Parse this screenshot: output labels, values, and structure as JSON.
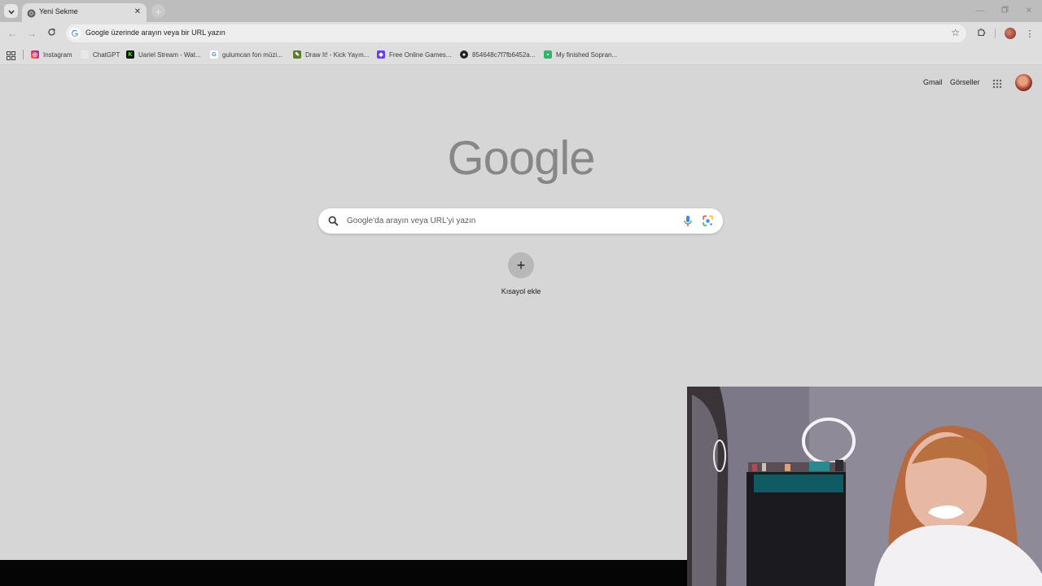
{
  "tab": {
    "title": "Yeni Sekme"
  },
  "omnibox": {
    "text": "Google üzerinde arayın veya bir URL yazın"
  },
  "bookmarks": [
    {
      "label": "Instagram",
      "icon": "instagram-icon",
      "color": "#d6249f"
    },
    {
      "label": "ChatGPT",
      "icon": "chatgpt-icon",
      "color": "#e8e8e8"
    },
    {
      "label": "Uariel Stream - Wat...",
      "icon": "kick-icon",
      "color": "#111111"
    },
    {
      "label": "gulumcan fon müzi...",
      "icon": "google-icon",
      "color": "#ffffff"
    },
    {
      "label": "Draw It! - Kick Yayın...",
      "icon": "drawit-icon",
      "color": "#5a7d2a"
    },
    {
      "label": "Free Online Games...",
      "icon": "shield-icon",
      "color": "#6a3de8"
    },
    {
      "label": "854648c7f7fb6452a...",
      "icon": "github-icon",
      "color": "#222222"
    },
    {
      "label": "My finished Sopran...",
      "icon": "chat-icon",
      "color": "#35b36b"
    }
  ],
  "header_links": {
    "gmail": "Gmail",
    "images": "Görseller"
  },
  "logo_text": "Google",
  "search": {
    "placeholder": "Google'da arayın veya URL'yi yazın"
  },
  "shortcut": {
    "label": "Kısayol ekle"
  }
}
